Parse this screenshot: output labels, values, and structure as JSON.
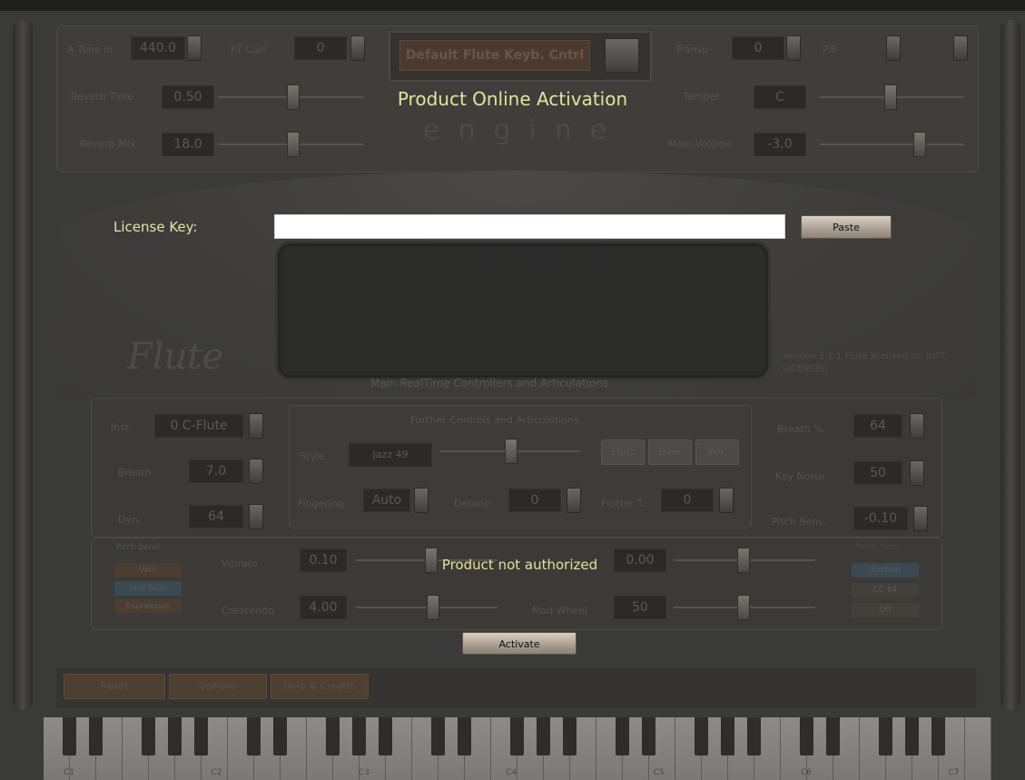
{
  "dialog": {
    "title": "Product Online Activation",
    "license_label": "License Key:",
    "license_value": "",
    "paste_label": "Paste",
    "status_text": "Product not authorized",
    "activate_label": "Activate"
  },
  "background": {
    "top_left": [
      {
        "label": "A Tune in",
        "value": "440.0"
      },
      {
        "label": "Reverb Time",
        "value": "0.50"
      },
      {
        "label": "Reverb Mix",
        "value": "18.0"
      }
    ],
    "kt_label": "KT Curr",
    "kt_value": "0",
    "preset_name": "Default Flute Keyb. Cntrl",
    "engine_text": "engine",
    "top_right": [
      {
        "label": "Transp.",
        "value": "0"
      },
      {
        "label": "Temper.",
        "value": "C"
      },
      {
        "label": "Main Volume",
        "value": "-3.0"
      }
    ],
    "pb_label": "P.B.",
    "flute_logo": "Flute",
    "mid_caption": "Main RealTime Controllers and Articulations",
    "version_text": "Version 2.1.1 Flute licensed to: NOT LICENSED",
    "left_controls": [
      {
        "label": "Inst",
        "value": "0 C-Flute"
      },
      {
        "label": "Breath",
        "value": "7.0"
      },
      {
        "label": "Dyn.",
        "value": "64"
      }
    ],
    "further_title": "Further Controls and Articulations",
    "style_label": "Style",
    "style_value": "Jazz",
    "style_num": "49",
    "art_buttons": [
      "Flutt",
      "Over",
      "Wh."
    ],
    "fingering_label": "Fingering",
    "fingering_value": "Auto",
    "detune_label": "Detune",
    "detune_value": "0",
    "flutter_label": "Flutter T.",
    "flutter_value": "0",
    "right_controls": [
      {
        "label": "Breath %",
        "value": "64"
      },
      {
        "label": "Key Noise",
        "value": "50"
      },
      {
        "label": "Pitch Sens.",
        "value": "-0.10"
      }
    ],
    "low_left_title": "Pitch bend",
    "low_left_buttons": [
      "Vari.",
      "Jazz Falls",
      "Expression"
    ],
    "low_controls": [
      {
        "label": "Vibrato",
        "value": "0.10"
      },
      {
        "label": "Crescendo",
        "value": "4.00"
      },
      {
        "label": "",
        "value": "0.00"
      },
      {
        "label": "Mod Wheel",
        "value": "50"
      }
    ],
    "low_right_title": "Pedal func.",
    "low_right_buttons": [
      "Sustain",
      "CC 64",
      "Off"
    ],
    "bottom_buttons": [
      "Reset",
      "Options",
      "Help & Credits"
    ],
    "keyboard_labels": [
      "C1",
      "C2",
      "C3",
      "C4",
      "C5",
      "C6",
      "C7"
    ],
    "colors": {
      "dialog_text": "#e7e29a",
      "input_bg": "#ffffff",
      "button_face": "#a99e92"
    }
  }
}
